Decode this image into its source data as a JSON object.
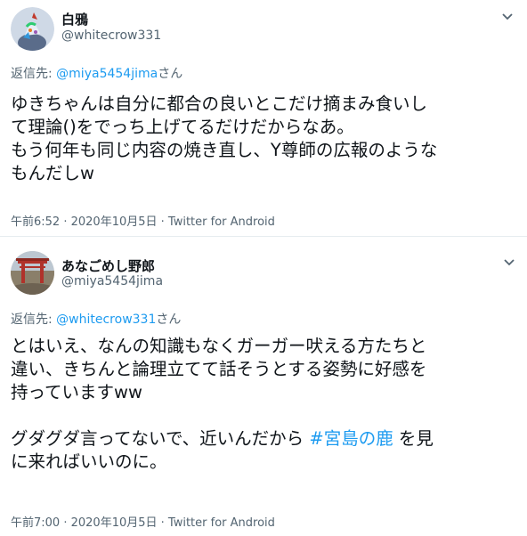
{
  "tweets": [
    {
      "display_name": "白鴉",
      "handle": "@whitecrow331",
      "reply_prefix": "返信先: ",
      "reply_to": "@miya5454jima",
      "reply_suffix": "さん",
      "lines": [
        "ゆきちゃんは自分に都合の良いとこだけ摘まみ食いし",
        "て理論()をでっち上げてるだけだからなあ。",
        "もう何年も同じ内容の焼き直し、Y尊師の広報のような",
        "もんだしw"
      ],
      "time": "午前6:52",
      "sep": " · ",
      "date": "2020年10月5日",
      "sep2": " · ",
      "source": "Twitter for Android"
    },
    {
      "display_name": "あなごめし野郎",
      "handle": "@miya5454jima",
      "reply_prefix": "返信先: ",
      "reply_to": "@whitecrow331",
      "reply_suffix": "さん",
      "lines": [
        "とはいえ、なんの知識もなくガーガー吠える方たちと",
        "違い、きちんと論理立てて話そうとする姿勢に好感を",
        "持っていますww"
      ],
      "line4_pre": "グダグダ言ってないで、近いんだから ",
      "hashtag": "#宮島の鹿",
      "line4_post": " を見",
      "line5": "に来ればいいのに。",
      "time": "午前7:00",
      "sep": " · ",
      "date": "2020年10月5日",
      "sep2": " · ",
      "source": "Twitter for Android"
    }
  ],
  "colors": {
    "link": "#1d9bf0",
    "secondary": "#536471",
    "divider": "#e6ecf0"
  },
  "icons": {
    "more": "chevron-down-icon"
  }
}
